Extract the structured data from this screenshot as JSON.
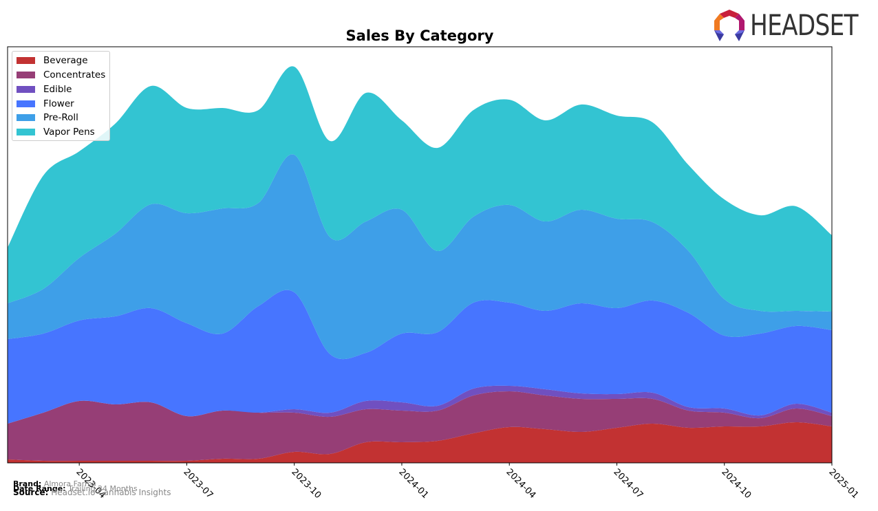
{
  "brand_logo": "HEADSET",
  "chart_data": {
    "type": "area",
    "stacked": true,
    "title": "Sales By Category",
    "xlabel": "",
    "ylabel": "",
    "x": [
      "2023-02",
      "2023-03",
      "2023-04",
      "2023-05",
      "2023-06",
      "2023-07",
      "2023-08",
      "2023-09",
      "2023-10",
      "2023-11",
      "2023-12",
      "2024-01",
      "2024-02",
      "2024-03",
      "2024-04",
      "2024-05",
      "2024-06",
      "2024-07",
      "2024-08",
      "2024-09",
      "2024-10",
      "2024-11",
      "2024-12",
      "2025-01"
    ],
    "xticks": [
      "2023-04",
      "2023-07",
      "2023-10",
      "2024-01",
      "2024-04",
      "2024-07",
      "2024-10",
      "2025-01"
    ],
    "ylim": [
      0,
      605
    ],
    "y_ticks_shown": false,
    "grid": false,
    "legend_position": "top-left",
    "series": [
      {
        "name": "Beverage",
        "color": "#c23232",
        "values": [
          5,
          3,
          3,
          3,
          3,
          3,
          6,
          6,
          16,
          13,
          30,
          30,
          32,
          43,
          52,
          49,
          45,
          51,
          57,
          51,
          53,
          53,
          59,
          53
        ]
      },
      {
        "name": "Concentrates",
        "color": "#963e76",
        "values": [
          52,
          70,
          87,
          82,
          85,
          65,
          70,
          67,
          57,
          54,
          48,
          46,
          44,
          55,
          52,
          49,
          48,
          42,
          36,
          25,
          20,
          12,
          20,
          15
        ]
      },
      {
        "name": "Edible",
        "color": "#7050c0",
        "values": [
          0,
          0,
          0,
          0,
          0,
          0,
          0,
          0,
          5,
          6,
          12,
          12,
          7,
          10,
          8,
          9,
          8,
          7,
          9,
          5,
          6,
          4,
          7,
          5
        ]
      },
      {
        "name": "Flower",
        "color": "#4775ff",
        "values": [
          123,
          115,
          117,
          128,
          137,
          135,
          112,
          155,
          170,
          85,
          70,
          100,
          107,
          125,
          121,
          114,
          131,
          125,
          134,
          137,
          106,
          119,
          113,
          120
        ]
      },
      {
        "name": "Pre-Roll",
        "color": "#3e9fe8",
        "values": [
          52,
          65,
          91,
          120,
          151,
          160,
          182,
          150,
          200,
          170,
          191,
          180,
          118,
          125,
          142,
          130,
          136,
          130,
          114,
          90,
          53,
          33,
          22,
          27
        ]
      },
      {
        "name": "Vapor Pens",
        "color": "#33c4d2",
        "values": [
          81,
          165,
          155,
          160,
          172,
          153,
          146,
          135,
          128,
          140,
          187,
          130,
          150,
          155,
          153,
          147,
          153,
          150,
          145,
          125,
          145,
          139,
          152,
          111
        ]
      }
    ]
  },
  "footer": {
    "brand_label": "Brand:",
    "brand_value": "Almora Farms",
    "date_label": "Date Range:",
    "date_value": "Trailing 24 Months",
    "source_label": "Source:",
    "source_value": "Headset.io Cannabis Insights"
  }
}
